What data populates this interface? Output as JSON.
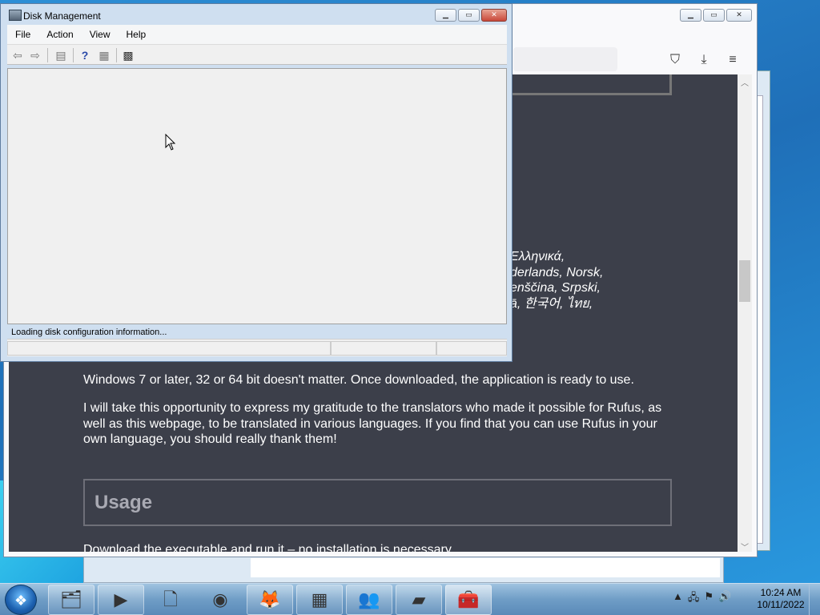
{
  "disk_mgmt": {
    "title": "Disk Management",
    "menu": [
      "File",
      "Action",
      "View",
      "Help"
    ],
    "status": "Loading disk configuration information..."
  },
  "firefox": {
    "lang_lines": [
      "Ελληνικά,",
      "derlands, Norsk,",
      "enščina, Srpski,",
      "ā, 한국어, ไทย,"
    ],
    "para1": "Windows 7 or later, 32 or 64 bit doesn't matter. Once downloaded, the application is ready to use.",
    "para2": "I will take this opportunity to express my gratitude to the translators who made it possible for Rufus, as well as this webpage, to be translated in various languages. If you find that you can use Rufus in your own language, you should really thank them!",
    "usage_heading": "Usage",
    "para3": "Download the executable and run it – no installation is necessary."
  },
  "taskbar": {
    "buttons": [
      "explorer",
      "media-player",
      "document",
      "chrome",
      "firefox",
      "control-panel",
      "users",
      "usb-drive",
      "toolbox"
    ],
    "clock_time": "10:24 AM",
    "clock_date": "10/11/2022"
  },
  "colors": {
    "page_bg": "#3c3f4a",
    "usage_heading": "#a9aab3"
  }
}
